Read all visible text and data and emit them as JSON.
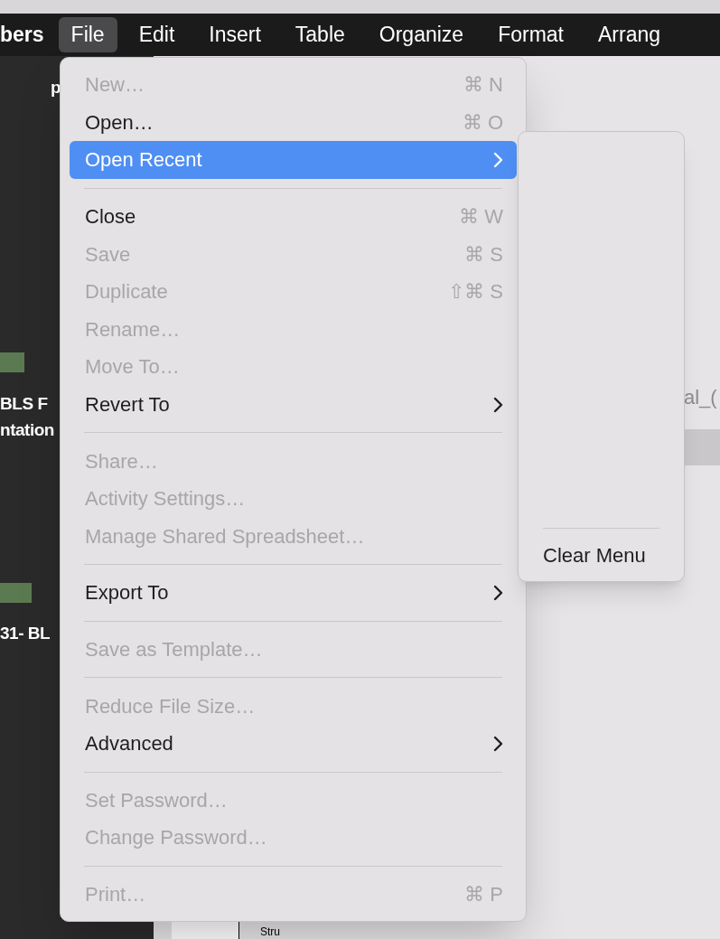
{
  "menu_bar": {
    "items": [
      {
        "kind": "app",
        "label": "bers",
        "selected": false
      },
      {
        "kind": "menu",
        "label": "File",
        "selected": true
      },
      {
        "kind": "menu",
        "label": "Edit",
        "selected": false
      },
      {
        "kind": "menu",
        "label": "Insert",
        "selected": false
      },
      {
        "kind": "menu",
        "label": "Table",
        "selected": false
      },
      {
        "kind": "menu",
        "label": "Organize",
        "selected": false
      },
      {
        "kind": "menu",
        "label": "Format",
        "selected": false
      },
      {
        "kind": "menu",
        "label": "Arrang",
        "selected": false
      }
    ]
  },
  "desktop": {
    "labels": [
      "p",
      "BLS F",
      "ntation",
      "31- BL"
    ]
  },
  "window": {
    "texts": [
      "al_(",
      "Stru"
    ]
  },
  "file_menu": {
    "items": [
      {
        "kind": "item",
        "label": "New…",
        "shortcut": "⌘ N",
        "disabled": true,
        "submenu": false,
        "selected": false
      },
      {
        "kind": "item",
        "label": "Open…",
        "shortcut": "⌘ O",
        "disabled": false,
        "submenu": false,
        "selected": false
      },
      {
        "kind": "item",
        "label": "Open Recent",
        "disabled": false,
        "submenu": true,
        "selected": true
      },
      {
        "kind": "separator"
      },
      {
        "kind": "item",
        "label": "Close",
        "shortcut": "⌘ W",
        "disabled": false,
        "submenu": false,
        "selected": false
      },
      {
        "kind": "item",
        "label": "Save",
        "shortcut": "⌘ S",
        "disabled": true,
        "submenu": false,
        "selected": false
      },
      {
        "kind": "item",
        "label": "Duplicate",
        "shortcut": "⇧⌘ S",
        "disabled": true,
        "submenu": false,
        "selected": false
      },
      {
        "kind": "item",
        "label": "Rename…",
        "disabled": true,
        "submenu": false,
        "selected": false
      },
      {
        "kind": "item",
        "label": "Move To…",
        "disabled": true,
        "submenu": false,
        "selected": false
      },
      {
        "kind": "item",
        "label": "Revert To",
        "disabled": false,
        "submenu": true,
        "selected": false
      },
      {
        "kind": "separator"
      },
      {
        "kind": "item",
        "label": "Share…",
        "disabled": true,
        "submenu": false,
        "selected": false
      },
      {
        "kind": "item",
        "label": "Activity Settings…",
        "disabled": true,
        "submenu": false,
        "selected": false
      },
      {
        "kind": "item",
        "label": "Manage Shared Spreadsheet…",
        "disabled": true,
        "submenu": false,
        "selected": false
      },
      {
        "kind": "separator"
      },
      {
        "kind": "item",
        "label": "Export To",
        "disabled": false,
        "submenu": true,
        "selected": false
      },
      {
        "kind": "separator"
      },
      {
        "kind": "item",
        "label": "Save as Template…",
        "disabled": true,
        "submenu": false,
        "selected": false
      },
      {
        "kind": "separator"
      },
      {
        "kind": "item",
        "label": "Reduce File Size…",
        "disabled": true,
        "submenu": false,
        "selected": false
      },
      {
        "kind": "item",
        "label": "Advanced",
        "disabled": false,
        "submenu": true,
        "selected": false
      },
      {
        "kind": "separator"
      },
      {
        "kind": "item",
        "label": "Set Password…",
        "disabled": true,
        "submenu": false,
        "selected": false
      },
      {
        "kind": "item",
        "label": "Change Password…",
        "disabled": true,
        "submenu": false,
        "selected": false
      },
      {
        "kind": "separator"
      },
      {
        "kind": "item",
        "label": "Print…",
        "shortcut": "⌘ P",
        "disabled": true,
        "submenu": false,
        "selected": false
      }
    ]
  },
  "open_recent_submenu": {
    "items": [
      {
        "kind": "separator"
      },
      {
        "kind": "item",
        "label": "Clear Menu",
        "disabled": false
      }
    ]
  }
}
